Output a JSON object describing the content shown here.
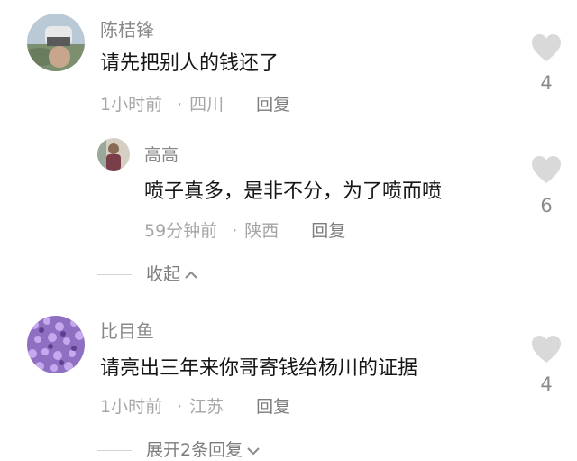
{
  "comments": [
    {
      "author": "陈桔锋",
      "text": "请先把别人的钱还了",
      "time": "1小时前",
      "separator": "·",
      "location": "四川",
      "reply_label": "回复",
      "likes": "4",
      "replies": [
        {
          "author": "高高",
          "text": "喷子真多，是非不分，为了喷而喷",
          "time": "59分钟前",
          "separator": "·",
          "location": "陕西",
          "reply_label": "回复",
          "likes": "6"
        }
      ],
      "toggle_label": "收起"
    },
    {
      "author": "比目鱼",
      "text": "请亮出三年来你哥寄钱给杨川的证据",
      "time": "1小时前",
      "separator": "·",
      "location": "江苏",
      "reply_label": "回复",
      "likes": "4",
      "toggle_label": "展开2条回复"
    }
  ],
  "icons": {
    "like": "heart-icon",
    "collapse": "chevron-up-icon",
    "expand": "chevron-down-icon"
  },
  "colors": {
    "like_icon": "#d9d9d9",
    "meta_text": "#a6a6a6",
    "name_text": "#888888"
  }
}
